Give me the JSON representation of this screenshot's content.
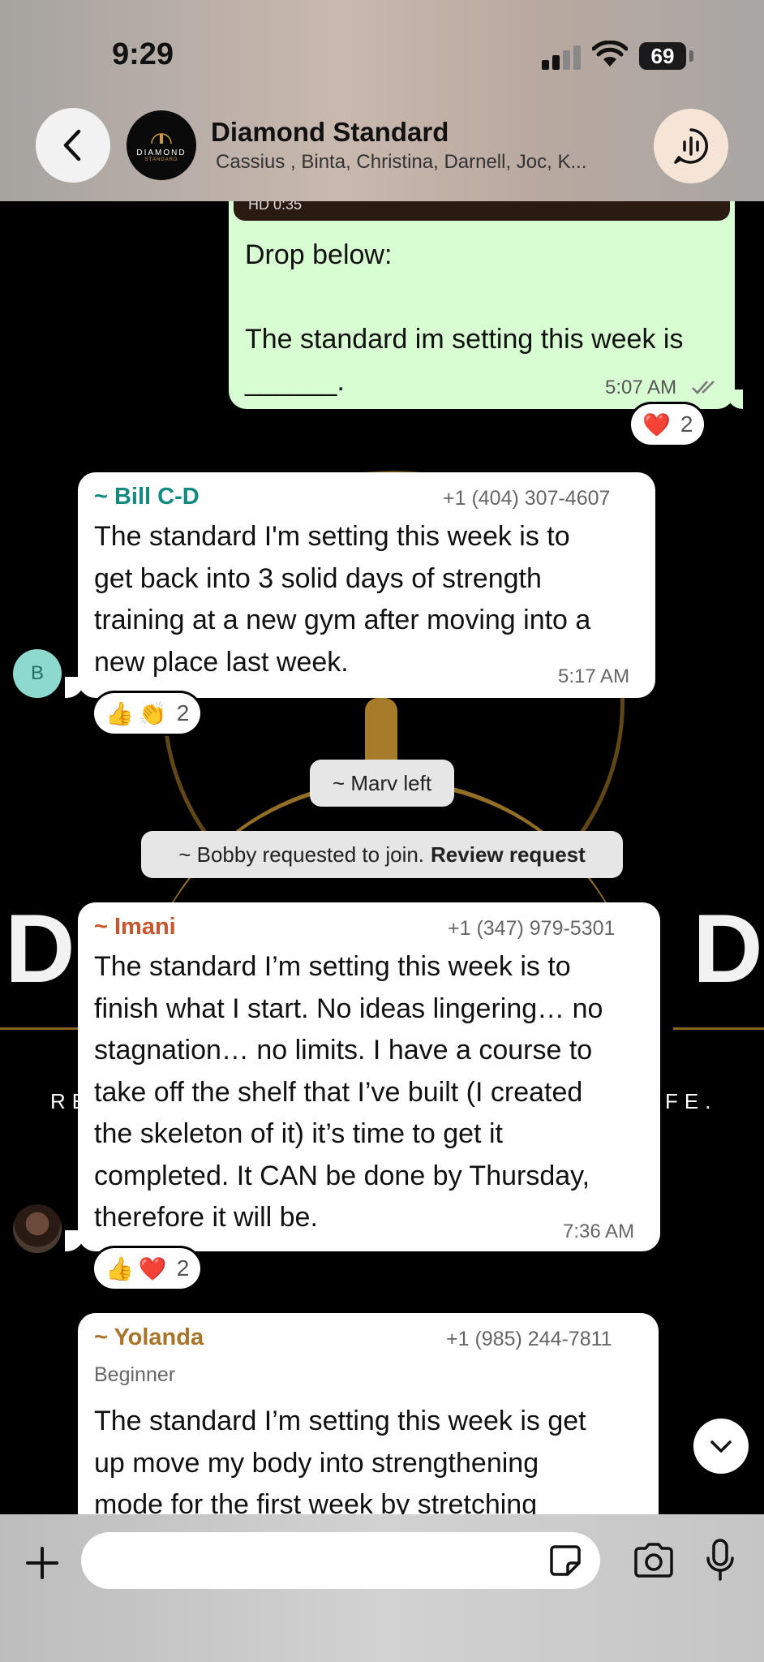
{
  "status_bar": {
    "time": "9:29",
    "battery": "69"
  },
  "header": {
    "title": "Diamond Standard",
    "members": "Cassius , Binta, Christina, Darnell, Joc, K...",
    "avatar_text": "DIAMOND",
    "avatar_sub": "STANDARD"
  },
  "background": {
    "letter_left": "D",
    "letter_right": "D",
    "text_left": "RE",
    "text_right": "FE."
  },
  "outgoing": {
    "video_hd": "HD 0:35",
    "line1": "Drop below:",
    "line2": "The standard im setting this week is",
    "line3": "______.",
    "time": "5:07 AM",
    "reaction_emoji": "❤️",
    "reaction_count": "2"
  },
  "messages": [
    {
      "sender": "~ Bill C-D",
      "phone": "+1 (404) 307-4607",
      "avatar_letter": "B",
      "lines": [
        "The standard I'm setting this week is to",
        "get back into 3 solid days of strength",
        "training at a new gym after moving into a",
        "new place last week."
      ],
      "time": "5:17 AM",
      "reaction_emoji1": "👍",
      "reaction_emoji2": "👏",
      "reaction_count": "2"
    },
    {
      "sender": "~ Imani",
      "phone": "+1 (347) 979-5301",
      "lines": [
        "The standard I’m setting this week is to",
        "finish what I start. No ideas lingering… no",
        "stagnation… no limits. I have a course to",
        "take off the shelf that I’ve built (I created",
        "the skeleton of it) it’s time to get it",
        "completed. It CAN be done by Thursday,",
        "therefore it will be."
      ],
      "time": "7:36 AM",
      "reaction_emoji1": "👍",
      "reaction_emoji2": "❤️",
      "reaction_count": "2"
    },
    {
      "sender": "~ Yolanda",
      "phone": "+1 (985) 244-7811",
      "subtitle": "Beginner",
      "lines": [
        "The standard I’m setting this week is  get",
        "up move my body into strengthening",
        "mode for the first week by stretching"
      ]
    }
  ],
  "system": {
    "left_notice": "~ Marv left",
    "join_notice": "~ Bobby requested to join.",
    "join_action": "Review request"
  },
  "composer": {
    "placeholder": ""
  },
  "colors": {
    "outgoing_bubble": "#d9fdd3",
    "bill_name": "#138a7e",
    "imani_name": "#c9552b",
    "yolanda_name": "#a8742a",
    "bill_avatar": "#8ed9cd"
  }
}
